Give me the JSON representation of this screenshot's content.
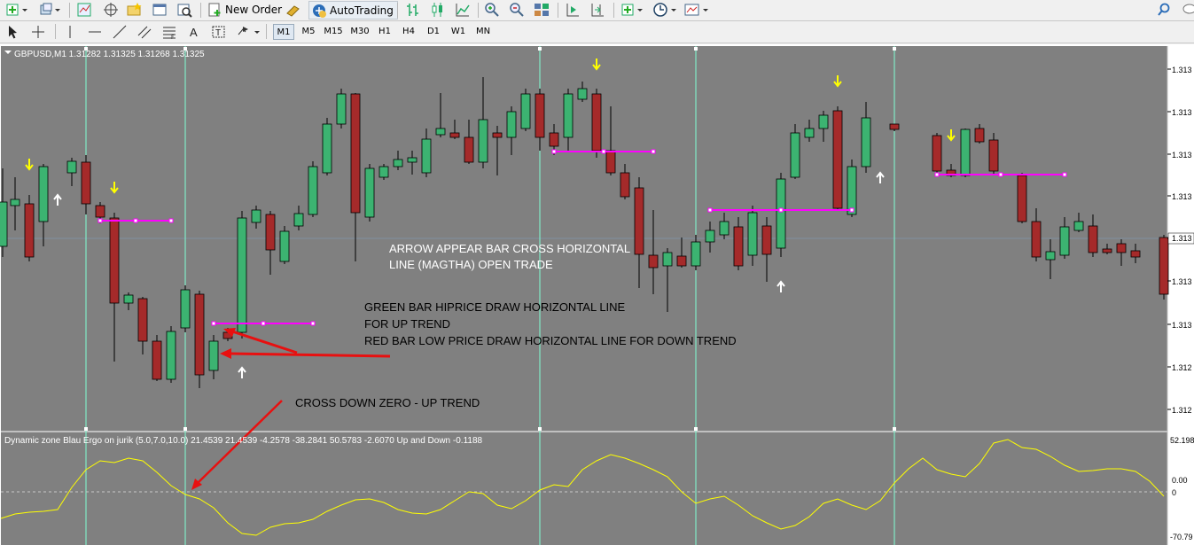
{
  "toolbar": {
    "new_order": "New Order",
    "autotrading": "AutoTrading",
    "timeframes": [
      "M1",
      "M5",
      "M15",
      "M30",
      "H1",
      "H4",
      "D1",
      "W1",
      "MN"
    ],
    "active_timeframe": "M1"
  },
  "chart": {
    "header": "GBPUSD,M1  1.31282 1.31325 1.31268 1.31325",
    "price_labels": [
      "1.3130",
      "1.3130",
      "1.3130",
      "1.3130",
      "1.3130",
      "1.3130",
      "1.3130",
      "1.3130",
      "1.3120"
    ],
    "price_labels_text": [
      "1.313",
      "1.313",
      "1.313",
      "1.313",
      "1.313",
      "1.313",
      "1.313",
      "1.312",
      "1.312"
    ],
    "current_price": "1.313",
    "annotations": [
      "ARROW APPEAR BAR CROSS HORIZONTAL",
      "LINE (MAGTHA) OPEN TRADE",
      "GREEN BAR HIPRICE DRAW HORIZONTAL LINE",
      "FOR UP TREND",
      "RED BAR LOW PRICE DRAW HORIZONTAL LINE FOR DOWN TREND",
      "CROSS DOWN ZERO - UP TREND"
    ]
  },
  "indicator": {
    "header": "Dynamic zone Blau Ergo on jurik (5.0,7.0,10.0) 21.4539 21.4539 -4.2578 -38.2841 50.5783 -2.6070  Up and Down -0.1188",
    "scale_labels": [
      "52.198",
      "0.00",
      "0",
      "-70.79"
    ]
  },
  "colors": {
    "chart_bg": "#808080",
    "bull": "#3cb371",
    "bear": "#a52a2a",
    "hline": "#ff00ff",
    "arrow_down": "#ffff00",
    "arrow_up": "#ffffff",
    "vline": "#7fffd4",
    "indicator_line": "#ffff00",
    "annotation_arrow": "#e81010"
  }
}
